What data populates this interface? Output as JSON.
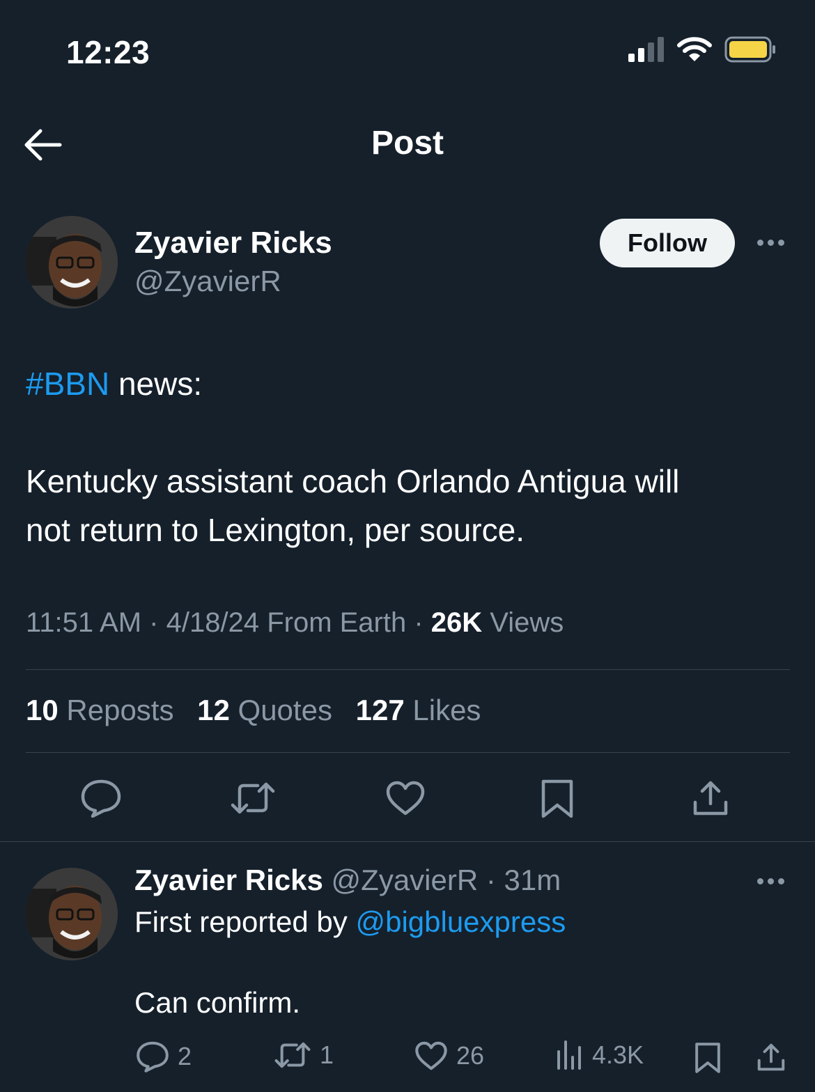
{
  "status_bar": {
    "time": "12:23"
  },
  "header": {
    "title": "Post"
  },
  "post": {
    "author_name": "Zyavier Ricks",
    "author_handle": "@ZyavierR",
    "follow_label": "Follow",
    "hashtag": "#BBN",
    "line1_rest": " news:",
    "line2": "Kentucky assistant coach Orlando Antigua will",
    "line3": "not return to Lexington, per source.",
    "time": "11:51 AM",
    "date": "4/18/24",
    "location": "From Earth",
    "views_count": "26K",
    "views_label": "Views",
    "reposts_count": "10",
    "reposts_label": "Reposts",
    "quotes_count": "12",
    "quotes_label": "Quotes",
    "likes_count": "127",
    "likes_label": "Likes"
  },
  "reply": {
    "author_name": "Zyavier Ricks",
    "author_handle": "@ZyavierR",
    "age": "31m",
    "text_prefix": "First reported by ",
    "mention": "@bigbluexpress",
    "text2": "Can confirm.",
    "replies": "2",
    "reposts": "1",
    "likes": "26",
    "views": "4.3K"
  },
  "colors": {
    "background": "#15202b",
    "link": "#1d9bf0",
    "muted": "#8b98a5",
    "battery": "#f5d547"
  }
}
